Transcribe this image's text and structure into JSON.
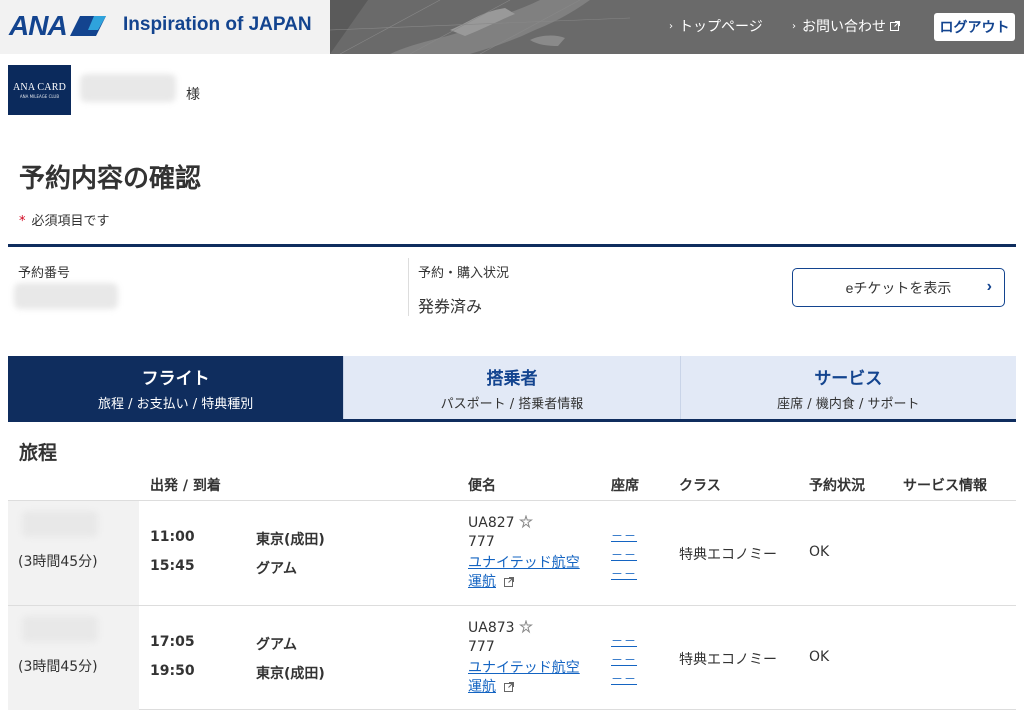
{
  "header": {
    "logo": "ANA",
    "tagline": "Inspiration of JAPAN",
    "nav": [
      {
        "label": "トップページ"
      },
      {
        "label": "お問い合わせ"
      }
    ],
    "logout": "ログアウト"
  },
  "user": {
    "card_line1": "ANA CARD",
    "card_line2": "ANA MILEAGE CLUB",
    "honorific": "様"
  },
  "page": {
    "title": "予約内容の確認",
    "required_mark": "*",
    "required_note": "必須項目です"
  },
  "reservation": {
    "number_label": "予約番号",
    "status_label": "予約・購入状況",
    "status_value": "発券済み",
    "eticket_button": "eチケットを表示"
  },
  "tabs": [
    {
      "title": "フライト",
      "sub": "旅程 / お支払い / 特典種別",
      "active": true
    },
    {
      "title": "搭乗者",
      "sub": "パスポート / 搭乗者情報",
      "active": false
    },
    {
      "title": "サービス",
      "sub": "座席 / 機内食 / サポート",
      "active": false
    }
  ],
  "itinerary": {
    "title": "旅程",
    "headers": {
      "dep_arr": "出発 / 到着",
      "flight": "便名",
      "seat": "座席",
      "class": "クラス",
      "status": "予約状況",
      "service": "サービス情報"
    },
    "rows": [
      {
        "duration": "(3時間45分)",
        "dep_time": "11:00",
        "dep_place": "東京(成田)",
        "arr_time": "15:45",
        "arr_place": "グアム",
        "flight_no": "UA827",
        "aircraft": "777",
        "operator_line1": "ユナイテッド航空",
        "operator_line2": "運航",
        "seats": [
          "－－",
          "－－",
          "－－"
        ],
        "class": "特典エコノミー",
        "status": "OK"
      },
      {
        "duration": "(3時間45分)",
        "dep_time": "17:05",
        "dep_place": "グアム",
        "arr_time": "19:50",
        "arr_place": "東京(成田)",
        "flight_no": "UA873",
        "aircraft": "777",
        "operator_line1": "ユナイテッド航空",
        "operator_line2": "運航",
        "seats": [
          "－－",
          "－－",
          "－－"
        ],
        "class": "特典エコノミー",
        "status": "OK"
      }
    ]
  },
  "colors": {
    "brand_navy": "#0f2d5e",
    "brand_blue": "#13448f",
    "link_blue": "#1464c2",
    "tab_inactive": "#e2e9f6",
    "required_red": "#d0021b"
  }
}
